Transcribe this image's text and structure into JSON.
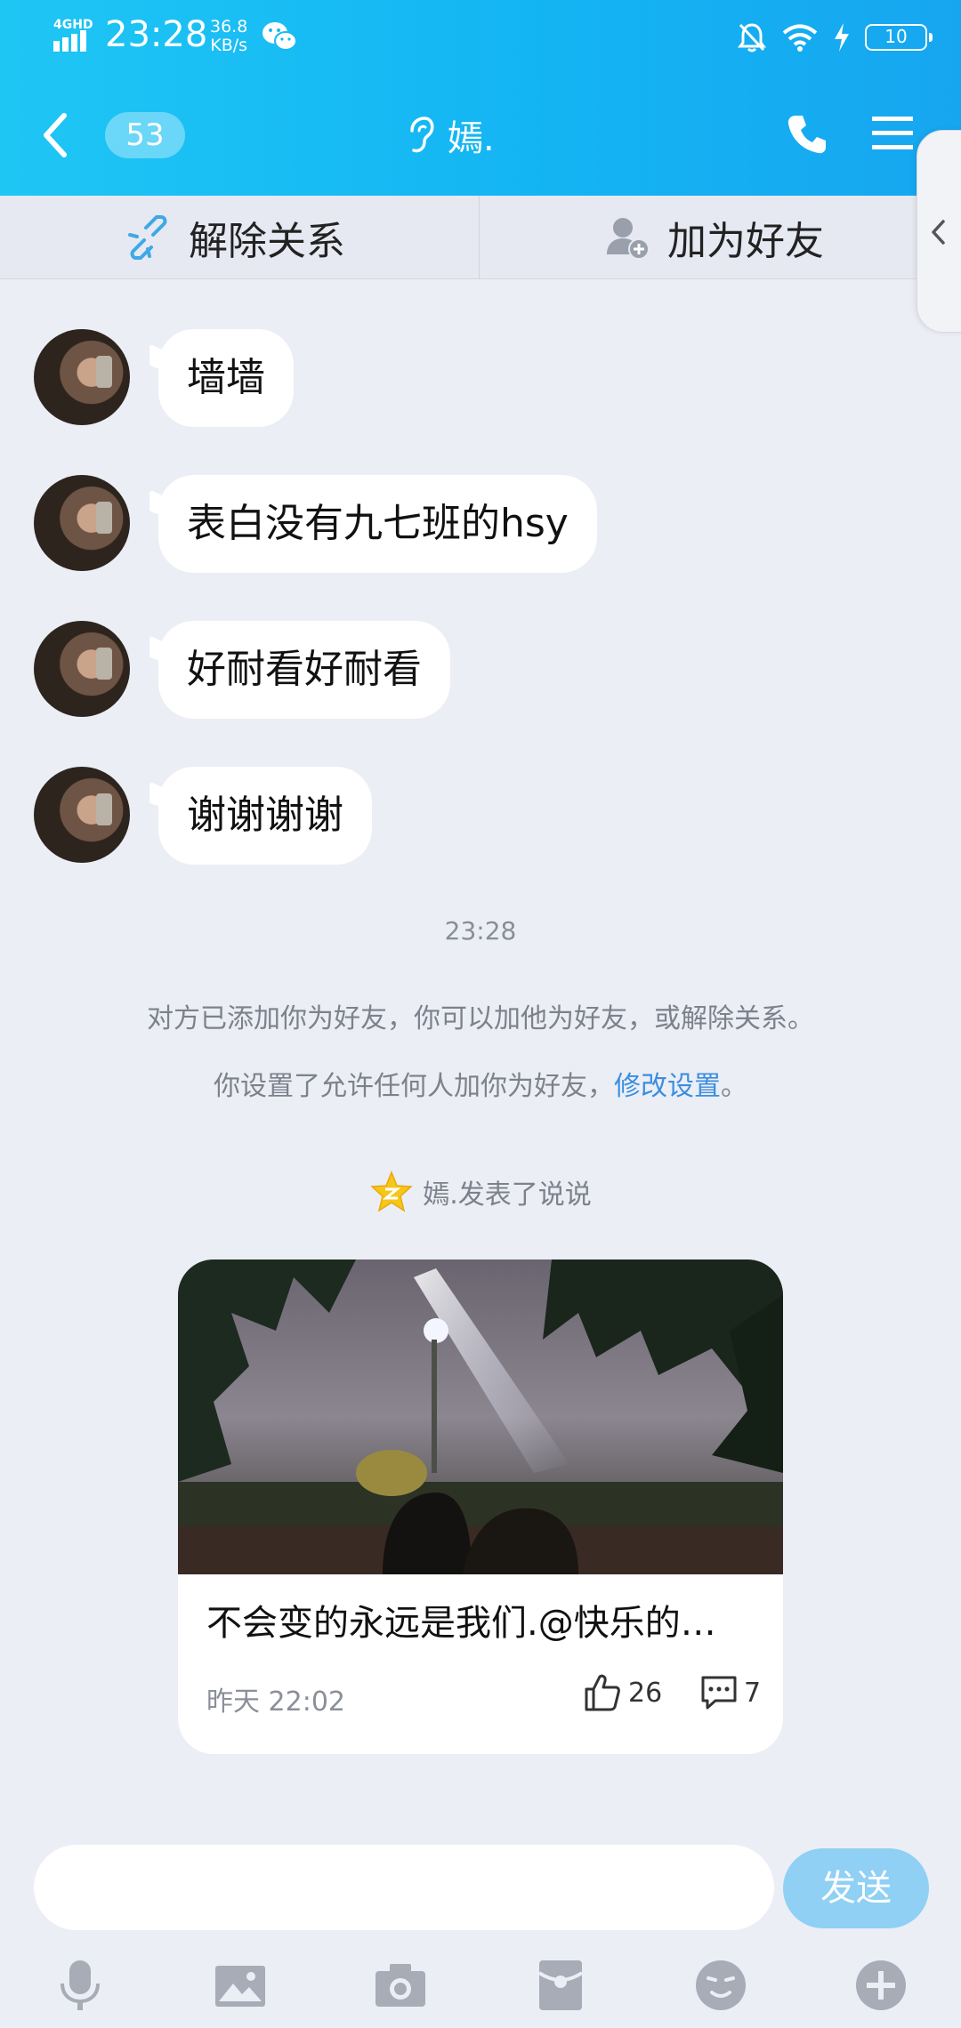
{
  "status_bar": {
    "network": "4GHD",
    "time": "23:28",
    "speed_value": "36.8",
    "speed_unit": "KB/s",
    "battery": "10"
  },
  "titlebar": {
    "unread_count": "53",
    "title": "嫣."
  },
  "action_bar": {
    "unlink_label": "解除关系",
    "add_friend_label": "加为好友"
  },
  "messages": [
    {
      "text": "墙墙"
    },
    {
      "text": "表白没有九七班的hsy"
    },
    {
      "text": "好耐看好耐看"
    },
    {
      "text": "谢谢谢谢"
    }
  ],
  "timestamp": "23:28",
  "notice": {
    "line1": "对方已添加你为好友，你可以加他为好友，或解除关系。",
    "line2_prefix": "你设置了允许任何人加你为好友，",
    "line2_link": "修改设置",
    "line2_suffix": "。"
  },
  "qzone": {
    "text": "嫣.发表了说说"
  },
  "feed_card": {
    "text": "不会变的永远是我们.@快乐的…",
    "time": "昨天 22:02",
    "likes": "26",
    "comments": "7"
  },
  "input": {
    "value": "",
    "send_label": "发送"
  },
  "colors": {
    "header_start": "#1ec6f4",
    "header_end": "#16a6f0",
    "background": "#eceef5",
    "link": "#3b8ee0",
    "send_button": "#8fd0f4"
  },
  "icons": [
    "back-icon",
    "ear-icon",
    "phone-icon",
    "menu-icon",
    "link-icon",
    "add-friend-icon",
    "qzone-star-icon",
    "like-icon",
    "comment-icon",
    "microphone-icon",
    "image-icon",
    "camera-icon",
    "red-packet-icon",
    "emoji-icon",
    "plus-icon"
  ]
}
